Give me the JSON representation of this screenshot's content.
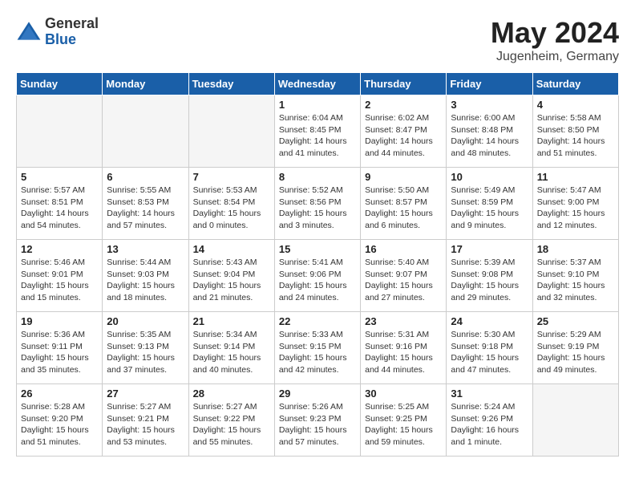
{
  "header": {
    "logo_general": "General",
    "logo_blue": "Blue",
    "month_title": "May 2024",
    "location": "Jugenheim, Germany"
  },
  "days_of_week": [
    "Sunday",
    "Monday",
    "Tuesday",
    "Wednesday",
    "Thursday",
    "Friday",
    "Saturday"
  ],
  "weeks": [
    {
      "days": [
        {
          "num": "",
          "empty": true
        },
        {
          "num": "",
          "empty": true
        },
        {
          "num": "",
          "empty": true
        },
        {
          "num": "1",
          "sunrise": "6:04 AM",
          "sunset": "8:45 PM",
          "daylight": "14 hours and 41 minutes."
        },
        {
          "num": "2",
          "sunrise": "6:02 AM",
          "sunset": "8:47 PM",
          "daylight": "14 hours and 44 minutes."
        },
        {
          "num": "3",
          "sunrise": "6:00 AM",
          "sunset": "8:48 PM",
          "daylight": "14 hours and 48 minutes."
        },
        {
          "num": "4",
          "sunrise": "5:58 AM",
          "sunset": "8:50 PM",
          "daylight": "14 hours and 51 minutes."
        }
      ]
    },
    {
      "alt": true,
      "days": [
        {
          "num": "5",
          "sunrise": "5:57 AM",
          "sunset": "8:51 PM",
          "daylight": "14 hours and 54 minutes."
        },
        {
          "num": "6",
          "sunrise": "5:55 AM",
          "sunset": "8:53 PM",
          "daylight": "14 hours and 57 minutes."
        },
        {
          "num": "7",
          "sunrise": "5:53 AM",
          "sunset": "8:54 PM",
          "daylight": "15 hours and 0 minutes."
        },
        {
          "num": "8",
          "sunrise": "5:52 AM",
          "sunset": "8:56 PM",
          "daylight": "15 hours and 3 minutes."
        },
        {
          "num": "9",
          "sunrise": "5:50 AM",
          "sunset": "8:57 PM",
          "daylight": "15 hours and 6 minutes."
        },
        {
          "num": "10",
          "sunrise": "5:49 AM",
          "sunset": "8:59 PM",
          "daylight": "15 hours and 9 minutes."
        },
        {
          "num": "11",
          "sunrise": "5:47 AM",
          "sunset": "9:00 PM",
          "daylight": "15 hours and 12 minutes."
        }
      ]
    },
    {
      "days": [
        {
          "num": "12",
          "sunrise": "5:46 AM",
          "sunset": "9:01 PM",
          "daylight": "15 hours and 15 minutes."
        },
        {
          "num": "13",
          "sunrise": "5:44 AM",
          "sunset": "9:03 PM",
          "daylight": "15 hours and 18 minutes."
        },
        {
          "num": "14",
          "sunrise": "5:43 AM",
          "sunset": "9:04 PM",
          "daylight": "15 hours and 21 minutes."
        },
        {
          "num": "15",
          "sunrise": "5:41 AM",
          "sunset": "9:06 PM",
          "daylight": "15 hours and 24 minutes."
        },
        {
          "num": "16",
          "sunrise": "5:40 AM",
          "sunset": "9:07 PM",
          "daylight": "15 hours and 27 minutes."
        },
        {
          "num": "17",
          "sunrise": "5:39 AM",
          "sunset": "9:08 PM",
          "daylight": "15 hours and 29 minutes."
        },
        {
          "num": "18",
          "sunrise": "5:37 AM",
          "sunset": "9:10 PM",
          "daylight": "15 hours and 32 minutes."
        }
      ]
    },
    {
      "alt": true,
      "days": [
        {
          "num": "19",
          "sunrise": "5:36 AM",
          "sunset": "9:11 PM",
          "daylight": "15 hours and 35 minutes."
        },
        {
          "num": "20",
          "sunrise": "5:35 AM",
          "sunset": "9:13 PM",
          "daylight": "15 hours and 37 minutes."
        },
        {
          "num": "21",
          "sunrise": "5:34 AM",
          "sunset": "9:14 PM",
          "daylight": "15 hours and 40 minutes."
        },
        {
          "num": "22",
          "sunrise": "5:33 AM",
          "sunset": "9:15 PM",
          "daylight": "15 hours and 42 minutes."
        },
        {
          "num": "23",
          "sunrise": "5:31 AM",
          "sunset": "9:16 PM",
          "daylight": "15 hours and 44 minutes."
        },
        {
          "num": "24",
          "sunrise": "5:30 AM",
          "sunset": "9:18 PM",
          "daylight": "15 hours and 47 minutes."
        },
        {
          "num": "25",
          "sunrise": "5:29 AM",
          "sunset": "9:19 PM",
          "daylight": "15 hours and 49 minutes."
        }
      ]
    },
    {
      "days": [
        {
          "num": "26",
          "sunrise": "5:28 AM",
          "sunset": "9:20 PM",
          "daylight": "15 hours and 51 minutes."
        },
        {
          "num": "27",
          "sunrise": "5:27 AM",
          "sunset": "9:21 PM",
          "daylight": "15 hours and 53 minutes."
        },
        {
          "num": "28",
          "sunrise": "5:27 AM",
          "sunset": "9:22 PM",
          "daylight": "15 hours and 55 minutes."
        },
        {
          "num": "29",
          "sunrise": "5:26 AM",
          "sunset": "9:23 PM",
          "daylight": "15 hours and 57 minutes."
        },
        {
          "num": "30",
          "sunrise": "5:25 AM",
          "sunset": "9:25 PM",
          "daylight": "15 hours and 59 minutes."
        },
        {
          "num": "31",
          "sunrise": "5:24 AM",
          "sunset": "9:26 PM",
          "daylight": "16 hours and 1 minute."
        },
        {
          "num": "",
          "empty": true
        }
      ]
    }
  ],
  "labels": {
    "sunrise": "Sunrise: ",
    "sunset": "Sunset: ",
    "daylight": "Daylight hours"
  }
}
